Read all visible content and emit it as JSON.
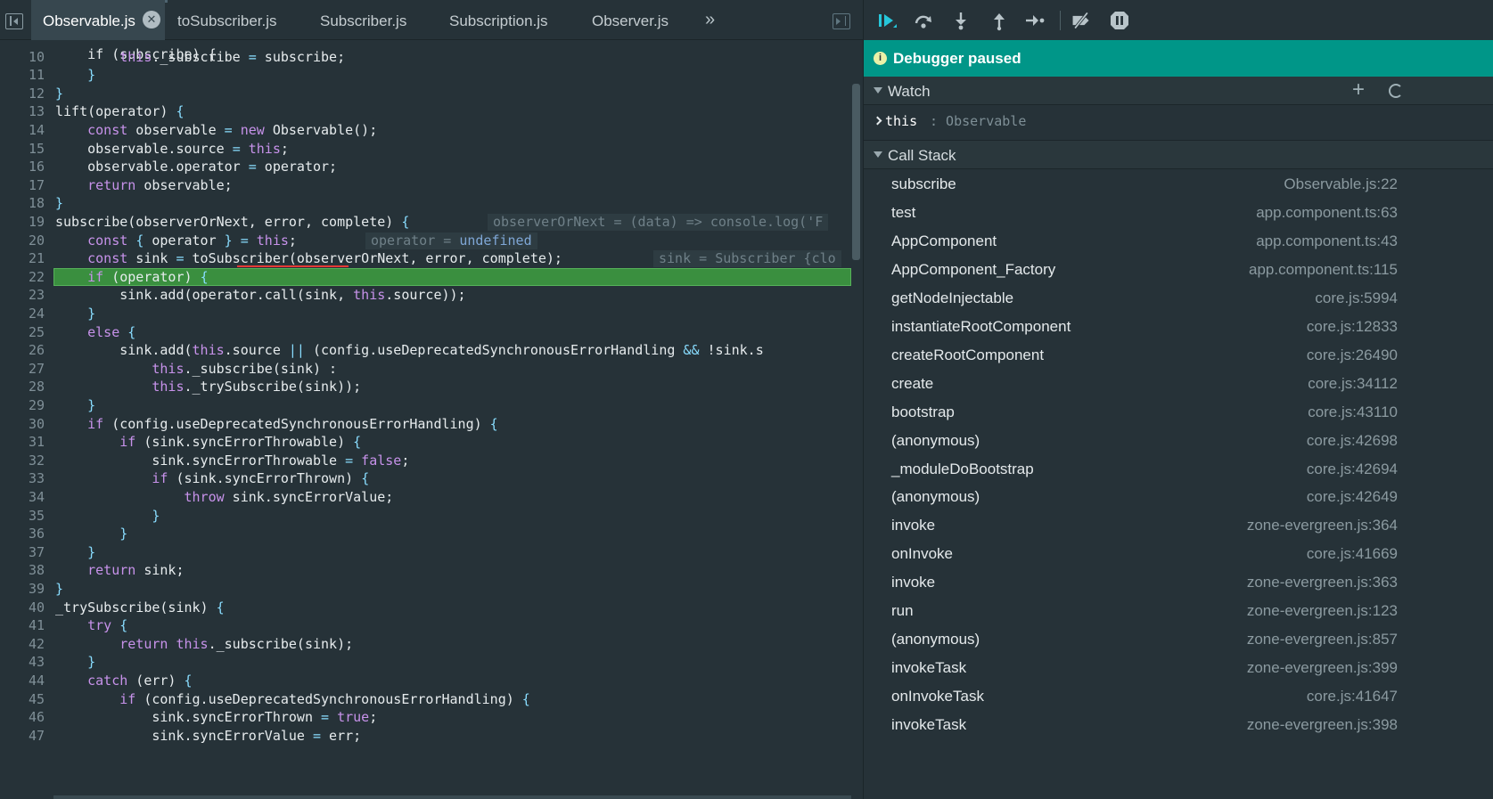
{
  "tabs": [
    {
      "label": "Observable.js",
      "active": true
    },
    {
      "label": "toSubscriber.js",
      "active": false
    },
    {
      "label": "Subscriber.js",
      "active": false
    },
    {
      "label": "Subscription.js",
      "active": false
    },
    {
      "label": "Observer.js",
      "active": false
    }
  ],
  "tabs_more": "»",
  "tab_close_glyph": "✕",
  "code": {
    "current_line": 22,
    "lines": [
      {
        "n": "10",
        "text": "        this._subscribe = subscribe;"
      },
      {
        "n": "11",
        "text": "    }"
      },
      {
        "n": "12",
        "text": "}"
      },
      {
        "n": "13",
        "text": "lift(operator) {"
      },
      {
        "n": "14",
        "text": "    const observable = new Observable();"
      },
      {
        "n": "15",
        "text": "    observable.source = this;"
      },
      {
        "n": "16",
        "text": "    observable.operator = operator;"
      },
      {
        "n": "17",
        "text": "    return observable;"
      },
      {
        "n": "18",
        "text": "}"
      },
      {
        "n": "19",
        "text": "subscribe(observerOrNext, error, complete) {"
      },
      {
        "n": "20",
        "text": "    const { operator } = this;"
      },
      {
        "n": "21",
        "text": "    const sink = toSubscriber(observerOrNext, error, complete);"
      },
      {
        "n": "22",
        "text": "    if (operator) {"
      },
      {
        "n": "23",
        "text": "        sink.add(operator.call(sink, this.source));"
      },
      {
        "n": "24",
        "text": "    }"
      },
      {
        "n": "25",
        "text": "    else {"
      },
      {
        "n": "26",
        "text": "        sink.add(this.source || (config.useDeprecatedSynchronousErrorHandling && !sink.s"
      },
      {
        "n": "27",
        "text": "            this._subscribe(sink) :"
      },
      {
        "n": "28",
        "text": "            this._trySubscribe(sink));"
      },
      {
        "n": "29",
        "text": "    }"
      },
      {
        "n": "30",
        "text": "    if (config.useDeprecatedSynchronousErrorHandling) {"
      },
      {
        "n": "31",
        "text": "        if (sink.syncErrorThrowable) {"
      },
      {
        "n": "32",
        "text": "            sink.syncErrorThrowable = false;"
      },
      {
        "n": "33",
        "text": "            if (sink.syncErrorThrown) {"
      },
      {
        "n": "34",
        "text": "                throw sink.syncErrorValue;"
      },
      {
        "n": "35",
        "text": "            }"
      },
      {
        "n": "36",
        "text": "        }"
      },
      {
        "n": "37",
        "text": "    }"
      },
      {
        "n": "38",
        "text": "    return sink;"
      },
      {
        "n": "39",
        "text": "}"
      },
      {
        "n": "40",
        "text": "_trySubscribe(sink) {"
      },
      {
        "n": "41",
        "text": "    try {"
      },
      {
        "n": "42",
        "text": "        return this._subscribe(sink);"
      },
      {
        "n": "43",
        "text": "    }"
      },
      {
        "n": "44",
        "text": "    catch (err) {"
      },
      {
        "n": "45",
        "text": "        if (config.useDeprecatedSynchronousErrorHandling) {"
      },
      {
        "n": "46",
        "text": "            sink.syncErrorThrown = true;"
      },
      {
        "n": "47",
        "text": "            sink.syncErrorValue = err;"
      }
    ],
    "top_partial": "    if (subscribe) {",
    "inline_values": [
      {
        "line": "19",
        "text": "observerOrNext = (data) => console.log('F"
      },
      {
        "line": "20",
        "name": "operator = ",
        "value": "undefined"
      },
      {
        "line": "21",
        "text": "sink = Subscriber {clo"
      }
    ]
  },
  "debugger": {
    "status": "Debugger paused",
    "watch": {
      "title": "Watch",
      "add": "+",
      "items": [
        {
          "key": "this",
          "value": ": Observable"
        }
      ]
    },
    "call_stack": {
      "title": "Call Stack",
      "frames": [
        {
          "name": "subscribe",
          "loc": "Observable.js:22"
        },
        {
          "name": "test",
          "loc": "app.component.ts:63"
        },
        {
          "name": "AppComponent",
          "loc": "app.component.ts:43"
        },
        {
          "name": "AppComponent_Factory",
          "loc": "app.component.ts:115"
        },
        {
          "name": "getNodeInjectable",
          "loc": "core.js:5994"
        },
        {
          "name": "instantiateRootComponent",
          "loc": "core.js:12833"
        },
        {
          "name": "createRootComponent",
          "loc": "core.js:26490"
        },
        {
          "name": "create",
          "loc": "core.js:34112"
        },
        {
          "name": "bootstrap",
          "loc": "core.js:43110"
        },
        {
          "name": "(anonymous)",
          "loc": "core.js:42698"
        },
        {
          "name": "_moduleDoBootstrap",
          "loc": "core.js:42694"
        },
        {
          "name": "(anonymous)",
          "loc": "core.js:42649"
        },
        {
          "name": "invoke",
          "loc": "zone-evergreen.js:364"
        },
        {
          "name": "onInvoke",
          "loc": "core.js:41669"
        },
        {
          "name": "invoke",
          "loc": "zone-evergreen.js:363"
        },
        {
          "name": "run",
          "loc": "zone-evergreen.js:123"
        },
        {
          "name": "(anonymous)",
          "loc": "zone-evergreen.js:857"
        },
        {
          "name": "invokeTask",
          "loc": "zone-evergreen.js:399"
        },
        {
          "name": "onInvokeTask",
          "loc": "core.js:41647"
        },
        {
          "name": "invokeTask",
          "loc": "zone-evergreen.js:398"
        }
      ]
    }
  },
  "colors": {
    "banner": "#009688",
    "current_line": "#3a8f3f",
    "keyword": "#c792ea",
    "resume_icon": "#26c6da"
  }
}
